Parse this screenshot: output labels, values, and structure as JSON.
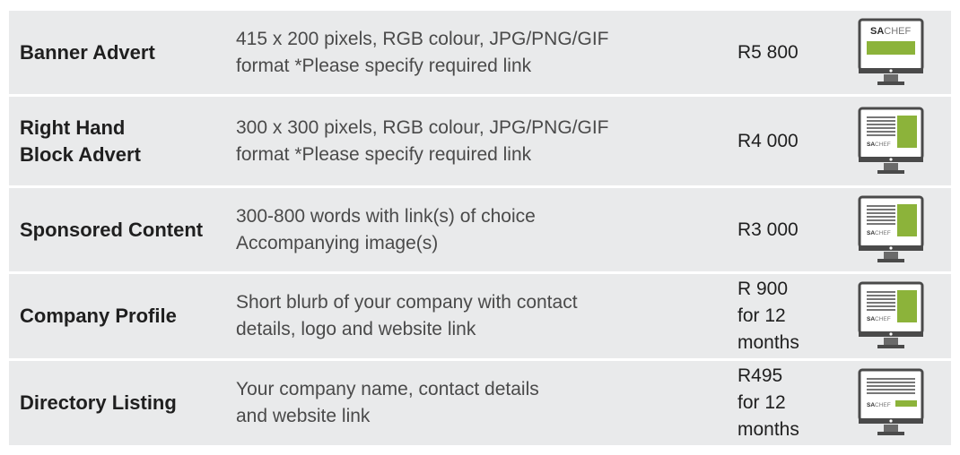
{
  "rows": [
    {
      "name": "Banner Advert",
      "desc1": "415 x 200 pixels, RGB colour, JPG/PNG/GIF",
      "desc2": "format *Please specify required link",
      "price1": "R5 800",
      "price2": "",
      "price3": "",
      "icon": "banner-ad-monitor-icon"
    },
    {
      "name": "Right Hand",
      "name2": "Block Advert",
      "desc1": "300 x 300 pixels, RGB colour, JPG/PNG/GIF",
      "desc2": "format *Please specify required link",
      "price1": "R4 000",
      "price2": "",
      "price3": "",
      "icon": "block-ad-monitor-icon"
    },
    {
      "name": "Sponsored Content",
      "desc1": "300-800 words with link(s) of choice",
      "desc2": "Accompanying image(s)",
      "price1": "R3 000",
      "price2": "",
      "price3": "",
      "icon": "block-ad-monitor-icon"
    },
    {
      "name": "Company Profile",
      "desc1": "Short blurb of your company with contact",
      "desc2": "details, logo and website link",
      "price1": "R 900",
      "price2": "for 12",
      "price3": "months",
      "icon": "block-ad-monitor-icon"
    },
    {
      "name": "Directory Listing",
      "desc1": "Your company name, contact details",
      "desc2": "and website link",
      "price1": "R495",
      "price2": "for 12",
      "price3": "months",
      "icon": "listing-monitor-icon"
    }
  ],
  "logo": {
    "part1": "SA",
    "part2": "CHEF"
  },
  "colors": {
    "accent": "#8cb33a",
    "row_bg": "#e9eaeb",
    "monitor": "#4a4a4a"
  }
}
